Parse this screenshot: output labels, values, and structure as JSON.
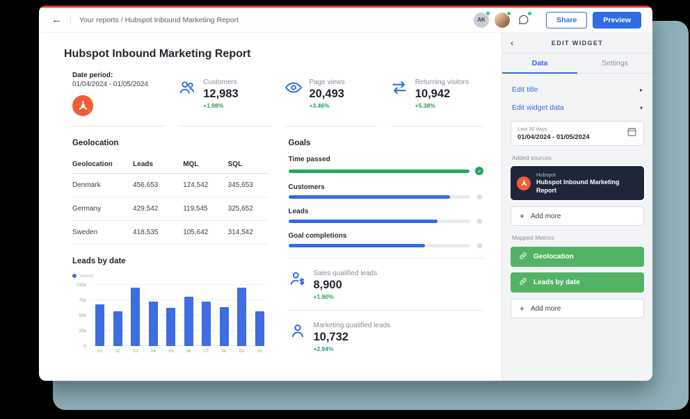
{
  "header": {
    "breadcrumb": "Your reports / Hubspot Inbound Marketing Report",
    "avatar_initials": "AK",
    "share_label": "Share",
    "preview_label": "Preview"
  },
  "icons": {
    "back_arrow": "←",
    "chevron_left": "‹",
    "caret_right": "▸",
    "caret_down": "▾",
    "plus": "+",
    "check": "✓"
  },
  "colors": {
    "accent_blue": "#2e6be4",
    "positive_green": "#18a558",
    "metric_green": "#53b364",
    "goal_green": "#1fa95c",
    "hubspot_orange": "#f25c36",
    "top_accent_red": "#e8392e",
    "dark_card": "#20263a",
    "backdrop_teal": "#8fb1ba"
  },
  "report": {
    "title": "Hubspot Inbound Marketing Report",
    "date_period": {
      "label": "Date period:",
      "value": "01/04/2024 - 01/05/2024"
    },
    "kpis": [
      {
        "label": "Customers",
        "value": "12,983",
        "delta": "+1.98%",
        "icon": "people-icon"
      },
      {
        "label": "Page views",
        "value": "20,493",
        "delta": "+3.46%",
        "icon": "eye-icon"
      },
      {
        "label": "Returning visitors",
        "value": "10,942",
        "delta": "+5.38%",
        "icon": "arrows-icon"
      }
    ],
    "geolocation": {
      "title": "Geolocation",
      "columns": [
        "Geolocation",
        "Leads",
        "MQL",
        "SQL"
      ],
      "rows": [
        [
          "Denmark",
          "456,653",
          "124,542",
          "345,653"
        ],
        [
          "Germany",
          "429,542",
          "119,545",
          "325,652"
        ],
        [
          "Sweden",
          "418,535",
          "105,642",
          "314,542"
        ]
      ]
    },
    "goals": {
      "title": "Goals",
      "items": [
        {
          "label": "Time passed",
          "percent": 100,
          "color": "#1fa95c",
          "complete": true
        },
        {
          "label": "Customers",
          "percent": 89,
          "color": "#2e6be4",
          "complete": false
        },
        {
          "label": "Leads",
          "percent": 82,
          "color": "#2e6be4",
          "complete": false
        },
        {
          "label": "Goal completions",
          "percent": 75,
          "color": "#2e6be4",
          "complete": false
        }
      ]
    },
    "bottom_stats": [
      {
        "label": "Sales qualified leads",
        "value": "8,900",
        "delta": "+1.90%",
        "icon": "person-dollar-icon"
      },
      {
        "label": "Marketing qualified leads",
        "value": "10,732",
        "delta": "+2.94%",
        "icon": "person-icon"
      }
    ]
  },
  "chart_data": {
    "type": "bar",
    "title": "Leads by date",
    "categories": [
      "01",
      "02",
      "03",
      "04",
      "05",
      "06",
      "07",
      "08",
      "09",
      "10"
    ],
    "values": [
      68000,
      57000,
      95000,
      73000,
      62000,
      81000,
      73000,
      64000,
      95000,
      57000
    ],
    "ylim": [
      0,
      100000
    ],
    "ytick_labels": [
      "100k",
      "75k",
      "50k",
      "25k",
      "0"
    ],
    "bar_color": "#3e6ce2",
    "xlabel": "",
    "ylabel": "",
    "legend_position": "top-left",
    "grid": true
  },
  "panel": {
    "title": "EDIT WIDGET",
    "tabs": [
      {
        "label": "Data",
        "active": true
      },
      {
        "label": "Settings",
        "active": false
      }
    ],
    "edit_title_label": "Edit title",
    "edit_widget_data_label": "Edit widget data",
    "date_picker": {
      "preset": "Last 30 days",
      "range": "01/04/2024 - 01/05/2024"
    },
    "added_sources_label": "Added sources",
    "source": {
      "provider": "Hubspot",
      "name": "Hubspot Inbound Marketing Report"
    },
    "add_more_label": "Add more",
    "mapped_metrics_label": "Mapped Metrics",
    "metrics": [
      "Geolocation",
      "Leads by date"
    ]
  }
}
